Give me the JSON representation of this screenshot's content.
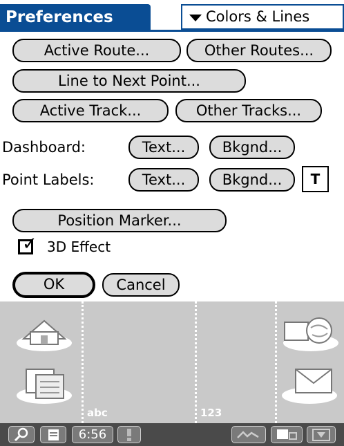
{
  "header": {
    "title": "Preferences",
    "category": "Colors & Lines"
  },
  "buttons": {
    "active_route": "Active Route...",
    "other_routes": "Other Routes...",
    "line_to_next": "Line to Next Point...",
    "active_track": "Active Track...",
    "other_tracks": "Other Tracks...",
    "dashboard_text": "Text...",
    "dashboard_bkgnd": "Bkgnd...",
    "labels_text": "Text...",
    "labels_bkgnd": "Bkgnd...",
    "t_box": "T",
    "position_marker": "Position Marker...",
    "ok": "OK",
    "cancel": "Cancel"
  },
  "labels": {
    "dashboard": "Dashboard:",
    "point_labels": "Point Labels:"
  },
  "checkbox": {
    "label": "3D Effect",
    "checked": true
  },
  "silkscreen": {
    "left_label": "abc",
    "right_label": "123"
  },
  "status_bar": {
    "time": "6:56"
  },
  "colors": {
    "accent": "#0a4d94",
    "button_bg": "#dcdcdc",
    "silkscreen": "#c9c9c9",
    "status_bar": "#4a4a4a"
  },
  "icons": [
    "home-icon",
    "menu-icon",
    "favorites-icon",
    "mail-icon",
    "search-icon",
    "clipboard-icon",
    "alert-icon",
    "signal-icon",
    "connection-icon",
    "download-icon"
  ]
}
